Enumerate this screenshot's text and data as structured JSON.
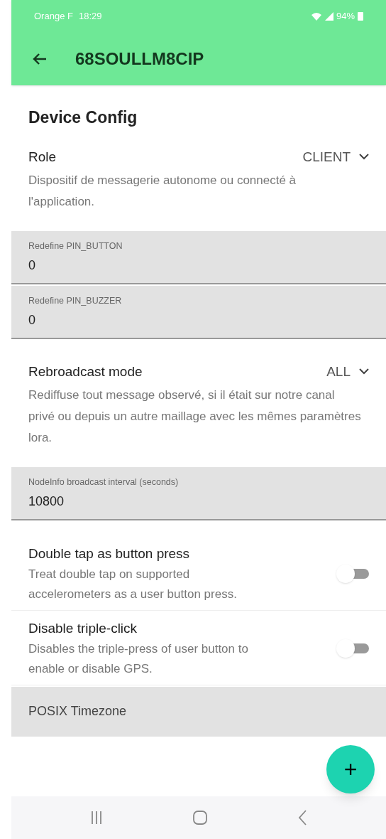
{
  "status_bar": {
    "carrier": "Orange F",
    "time": "18:29",
    "battery": "94%"
  },
  "app_bar": {
    "title": "68SOULLM8CIP"
  },
  "section_title": "Device Config",
  "items": [
    {
      "kind": "dropdown",
      "label": "Role",
      "value": "CLIENT",
      "description": "Dispositif de messagerie autonome ou connecté à l'application."
    },
    {
      "kind": "text_field",
      "label": "Redefine PIN_BUTTON",
      "value": "0"
    },
    {
      "kind": "text_field",
      "label": "Redefine PIN_BUZZER",
      "value": "0"
    },
    {
      "kind": "dropdown",
      "label": "Rebroadcast mode",
      "value": "ALL",
      "description": "Rediffuse tout message observé, si il était sur notre canal privé ou depuis un autre maillage avec les mêmes paramètres lora."
    },
    {
      "kind": "text_field",
      "label": "NodeInfo broadcast interval (seconds)",
      "value": "10800"
    },
    {
      "kind": "switch",
      "label": "Double tap as button press",
      "description": "Treat double tap on supported accelerometers as a user button press.",
      "on": false
    },
    {
      "kind": "switch",
      "label": "Disable triple-click",
      "description": "Disables the triple-press of user button to enable or disable GPS.",
      "on": false
    },
    {
      "kind": "collapsed",
      "label": "POSIX Timezone"
    }
  ],
  "fab": {
    "label": "+"
  }
}
